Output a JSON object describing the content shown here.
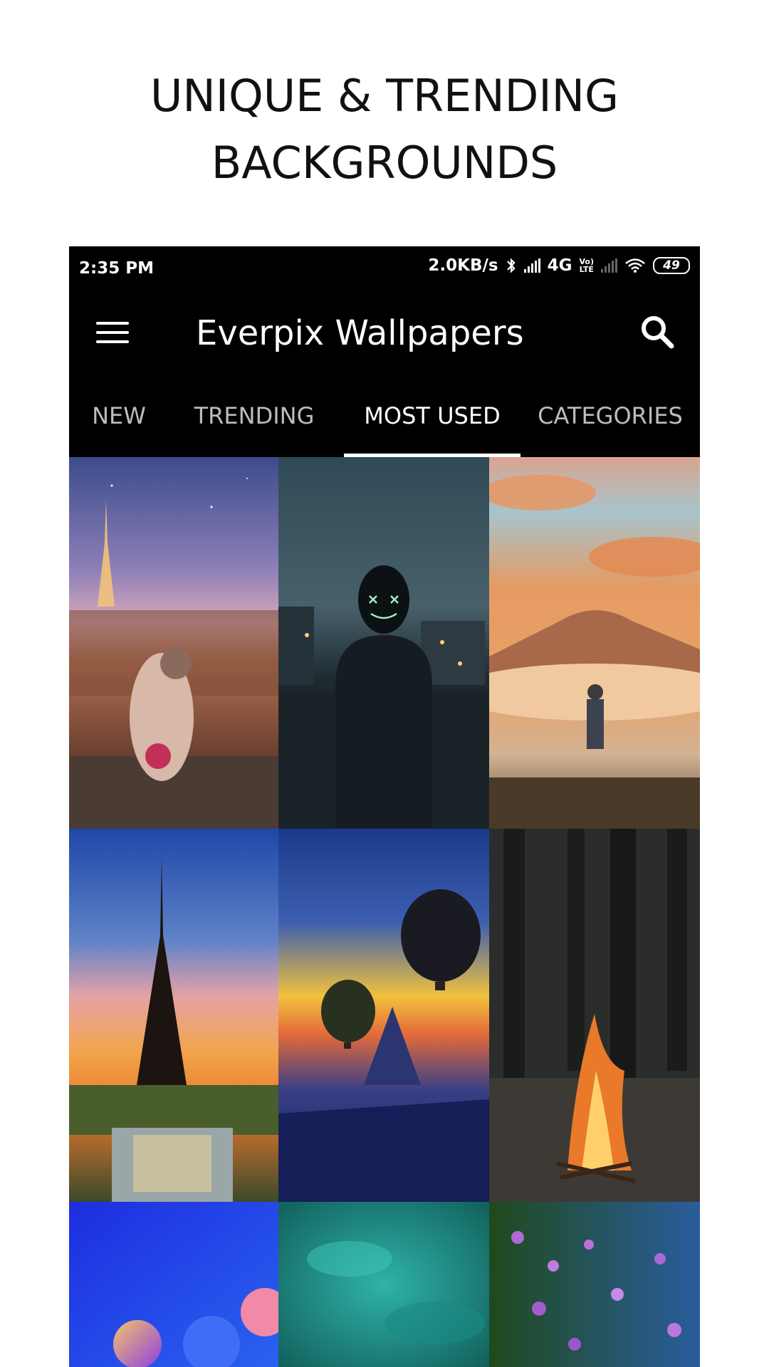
{
  "promo": {
    "line1": "UNIQUE & TRENDING",
    "line2": "BACKGROUNDS"
  },
  "status_bar": {
    "time": "2:35 PM",
    "network_speed": "2.0KB/s",
    "network_type": "4G",
    "volte_top": "Vo)",
    "volte_bottom": "LTE",
    "battery": "49",
    "icons": [
      "bluetooth-icon",
      "signal-icon",
      "signal-dim-icon",
      "wifi-icon",
      "battery-icon"
    ]
  },
  "app_bar": {
    "title": "Everpix Wallpapers",
    "menu_icon": "hamburger-menu-icon",
    "search_icon": "search-icon"
  },
  "tabs": [
    {
      "label": "NEW",
      "active": false
    },
    {
      "label": "TRENDING",
      "active": false
    },
    {
      "label": "MOST USED",
      "active": true
    },
    {
      "label": "CATEGORIES",
      "active": false
    }
  ],
  "wallpapers": [
    {
      "subject": "eiffel-tower-night-girl"
    },
    {
      "subject": "masked-hoodie-city"
    },
    {
      "subject": "mountain-sunset-clouds"
    },
    {
      "subject": "eiffel-tower-sunset"
    },
    {
      "subject": "hot-air-balloons"
    },
    {
      "subject": "forest-campfire"
    },
    {
      "subject": "abstract-blue-spheres"
    },
    {
      "subject": "teal-texture"
    },
    {
      "subject": "purple-flowers"
    }
  ],
  "colors": {
    "background": "#ffffff",
    "app_bar": "#000000",
    "tab_inactive": "#bdbdbd",
    "tab_active": "#ffffff"
  }
}
